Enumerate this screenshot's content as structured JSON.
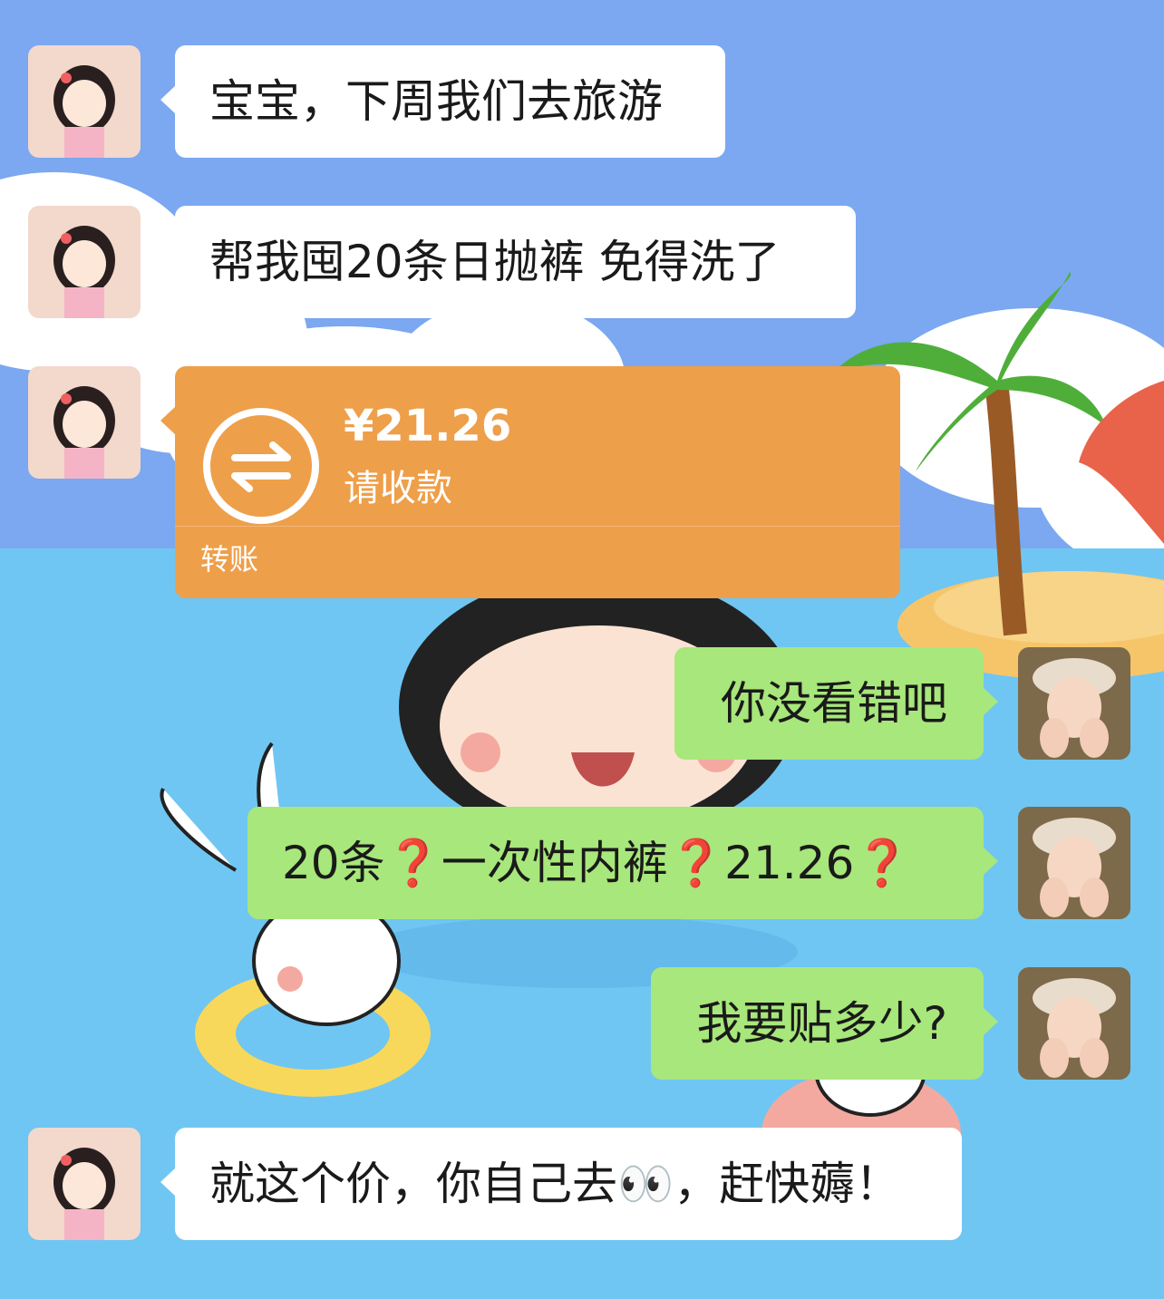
{
  "messages": [
    {
      "side": "left",
      "type": "text",
      "text": "宝宝，下周我们去旅游"
    },
    {
      "side": "left",
      "type": "text",
      "text": "帮我囤20条日抛裤 免得洗了"
    },
    {
      "side": "left",
      "type": "transfer",
      "amount": "¥21.26",
      "status": "请收款",
      "label": "转账"
    },
    {
      "side": "right",
      "type": "text",
      "text": "你没看错吧"
    },
    {
      "side": "right",
      "type": "text",
      "parts": [
        "20条",
        "❓",
        "一次性内裤",
        "❓",
        "21.26",
        "❓"
      ]
    },
    {
      "side": "right",
      "type": "text",
      "text": "我要贴多少?"
    },
    {
      "side": "left",
      "type": "text",
      "text": "就这个价，你自己去👀，赶快薅！"
    }
  ],
  "colors": {
    "sky": "#7ba8f0",
    "sea": "#6fc6f2",
    "bubble_white": "#ffffff",
    "bubble_green": "#a8e77b",
    "transfer_orange": "#ee9f4a"
  },
  "icons": {
    "transfer": "transfer-arrows-icon",
    "left_avatar": "girl-cartoon-avatar",
    "right_avatar": "girl-photo-avatar"
  }
}
